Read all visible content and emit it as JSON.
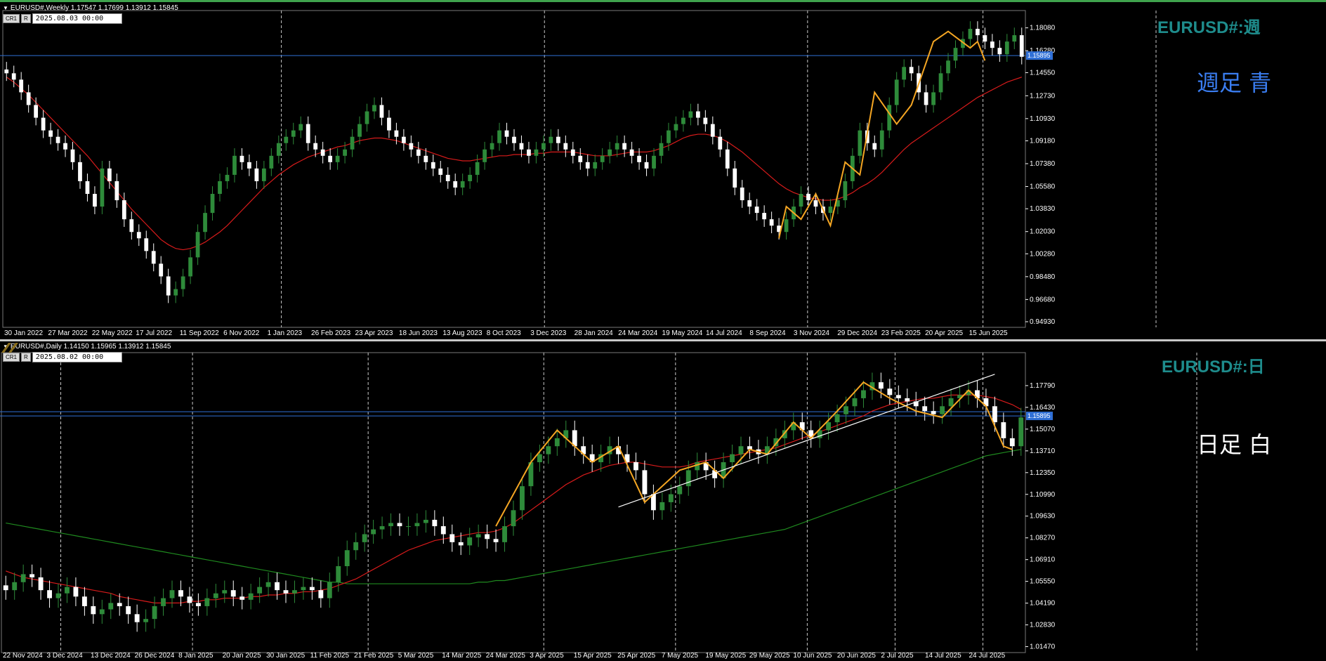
{
  "colors": {
    "background": "#000000",
    "bull": "#2e8b3a",
    "bear": "#ffffff",
    "ma_fast": "#d81b1b",
    "ma_slow": "#1f8a1f",
    "zigzag": "#f5a623",
    "hline": "#2f6fd6",
    "trendline": "#ffffff",
    "weekly_title": "#1e8c8c",
    "weekly_label": "#3a7df0",
    "daily_title": "#1e8c8c",
    "daily_label": "#ffffff",
    "grid": "#c8c8c8"
  },
  "panes": [
    {
      "id": "weekly",
      "header": "EURUSD#,Weekly  1.17547 1.17699 1.13912 1.15845",
      "buttons": [
        "CR1",
        "R"
      ],
      "date_field": "2025.08.03 00:00",
      "title": "EURUSD#:週",
      "label": "週足  青",
      "current_price": "1.15895"
    },
    {
      "id": "daily",
      "header": "EURUSD#,Daily  1.14150 1.15965 1.13912 1.15845",
      "buttons": [
        "CR1",
        "R"
      ],
      "date_field": "2025.08.02 00:00",
      "title": "EURUSD#:日",
      "label": "日足    白",
      "current_price": "1.15895"
    }
  ],
  "chart_data": [
    {
      "type": "candlestick",
      "timeframe": "Weekly",
      "symbol": "EURUSD#",
      "ylim": [
        0.9493,
        1.19
      ],
      "y_ticks": [
        "1.18080",
        "1.16280",
        "1.14550",
        "1.12730",
        "1.10930",
        "1.09180",
        "1.07380",
        "1.05580",
        "1.03830",
        "1.02030",
        "1.00280",
        "0.98480",
        "0.96680",
        "0.94930"
      ],
      "x_labels": [
        "30 Jan 2022",
        "27 Mar 2022",
        "22 May 2022",
        "17 Jul 2022",
        "11 Sep 2022",
        "6 Nov 2022",
        "1 Jan 2023",
        "26 Feb 2023",
        "23 Apr 2023",
        "18 Jun 2023",
        "13 Aug 2023",
        "8 Oct 2023",
        "3 Dec 2023",
        "28 Jan 2024",
        "24 Mar 2024",
        "19 May 2024",
        "14 Jul 2024",
        "8 Sep 2024",
        "3 Nov 2024",
        "29 Dec 2024",
        "23 Feb 2025",
        "20 Apr 2025",
        "15 Jun 2025"
      ],
      "grid_vertical_at": [
        "1 Jan 2023",
        "3 Dec 2023",
        "3 Nov 2024",
        "15 Jun 2025"
      ],
      "horizontal_line": 1.15895,
      "close_trace": [
        1.145,
        1.14,
        1.13,
        1.12,
        1.11,
        1.1,
        1.095,
        1.09,
        1.085,
        1.075,
        1.06,
        1.05,
        1.04,
        1.07,
        1.06,
        1.045,
        1.03,
        1.02,
        1.015,
        1.005,
        0.995,
        0.985,
        0.97,
        0.975,
        0.985,
        1.0,
        1.02,
        1.035,
        1.05,
        1.06,
        1.065,
        1.08,
        1.075,
        1.07,
        1.06,
        1.07,
        1.08,
        1.09,
        1.095,
        1.1,
        1.105,
        1.09,
        1.085,
        1.08,
        1.075,
        1.08,
        1.085,
        1.095,
        1.105,
        1.115,
        1.12,
        1.11,
        1.1,
        1.095,
        1.09,
        1.085,
        1.08,
        1.075,
        1.07,
        1.065,
        1.06,
        1.055,
        1.06,
        1.065,
        1.075,
        1.085,
        1.09,
        1.1,
        1.095,
        1.09,
        1.085,
        1.08,
        1.085,
        1.09,
        1.095,
        1.09,
        1.085,
        1.08,
        1.075,
        1.07,
        1.075,
        1.08,
        1.085,
        1.09,
        1.085,
        1.08,
        1.075,
        1.07,
        1.08,
        1.09,
        1.1,
        1.105,
        1.11,
        1.115,
        1.11,
        1.105,
        1.095,
        1.085,
        1.07,
        1.055,
        1.045,
        1.04,
        1.035,
        1.03,
        1.025,
        1.02,
        1.03,
        1.04,
        1.05,
        1.045,
        1.04,
        1.035,
        1.04,
        1.045,
        1.06,
        1.08,
        1.1,
        1.09,
        1.085,
        1.1,
        1.12,
        1.14,
        1.15,
        1.145,
        1.13,
        1.12,
        1.13,
        1.145,
        1.155,
        1.165,
        1.172,
        1.18,
        1.175,
        1.17,
        1.165,
        1.16,
        1.17,
        1.175,
        1.158
      ],
      "ma_red_trace": [
        1.142,
        1.138,
        1.133,
        1.128,
        1.122,
        1.116,
        1.11,
        1.104,
        1.098,
        1.092,
        1.086,
        1.08,
        1.073,
        1.066,
        1.059,
        1.052,
        1.045,
        1.038,
        1.032,
        1.026,
        1.02,
        1.014,
        1.01,
        1.007,
        1.006,
        1.007,
        1.009,
        1.012,
        1.016,
        1.02,
        1.025,
        1.031,
        1.037,
        1.043,
        1.049,
        1.055,
        1.06,
        1.065,
        1.069,
        1.073,
        1.076,
        1.079,
        1.081,
        1.083,
        1.085,
        1.087,
        1.088,
        1.09,
        1.092,
        1.093,
        1.094,
        1.094,
        1.093,
        1.092,
        1.09,
        1.088,
        1.086,
        1.084,
        1.082,
        1.08,
        1.078,
        1.077,
        1.076,
        1.076,
        1.077,
        1.078,
        1.079,
        1.08,
        1.08,
        1.081,
        1.081,
        1.081,
        1.082,
        1.082,
        1.083,
        1.083,
        1.083,
        1.083,
        1.082,
        1.081,
        1.08,
        1.08,
        1.08,
        1.081,
        1.082,
        1.083,
        1.083,
        1.083,
        1.084,
        1.086,
        1.088,
        1.091,
        1.094,
        1.096,
        1.097,
        1.097,
        1.096,
        1.094,
        1.091,
        1.087,
        1.083,
        1.078,
        1.073,
        1.068,
        1.063,
        1.058,
        1.054,
        1.051,
        1.049,
        1.047,
        1.046,
        1.045,
        1.045,
        1.046,
        1.048,
        1.051,
        1.055,
        1.058,
        1.062,
        1.067,
        1.073,
        1.079,
        1.085,
        1.09,
        1.094,
        1.098,
        1.102,
        1.106,
        1.11,
        1.114,
        1.118,
        1.122,
        1.126,
        1.129,
        1.132,
        1.135,
        1.138,
        1.14,
        1.142
      ],
      "zigzag": [
        [
          105,
          1.015
        ],
        [
          106,
          1.04
        ],
        [
          108,
          1.03
        ],
        [
          110,
          1.05
        ],
        [
          112,
          1.025
        ],
        [
          114,
          1.075
        ],
        [
          116,
          1.065
        ],
        [
          118,
          1.13
        ],
        [
          121,
          1.105
        ],
        [
          123,
          1.12
        ],
        [
          126,
          1.17
        ],
        [
          128,
          1.178
        ],
        [
          131,
          1.165
        ],
        [
          132,
          1.17
        ],
        [
          133,
          1.155
        ]
      ]
    },
    {
      "type": "candlestick",
      "timeframe": "Daily",
      "symbol": "EURUSD#",
      "ylim": [
        1.0145,
        1.195
      ],
      "y_ticks": [
        "1.17790",
        "1.16430",
        "1.15070",
        "1.13710",
        "1.12350",
        "1.10990",
        "1.09630",
        "1.08270",
        "1.06910",
        "1.05550",
        "1.04190",
        "1.02830",
        "1.01470"
      ],
      "x_labels": [
        "22 Nov 2024",
        "3 Dec 2024",
        "13 Dec 2024",
        "26 Dec 2024",
        "8 Jan 2025",
        "20 Jan 2025",
        "30 Jan 2025",
        "11 Feb 2025",
        "21 Feb 2025",
        "5 Mar 2025",
        "14 Mar 2025",
        "24 Mar 2025",
        "3 Apr 2025",
        "15 Apr 2025",
        "25 Apr 2025",
        "7 May 2025",
        "19 May 2025",
        "29 May 2025",
        "10 Jun 2025",
        "20 Jun 2025",
        "2 Jul 2025",
        "14 Jul 2025",
        "24 Jul 2025"
      ],
      "grid_vertical_at": [
        "3 Dec 2024",
        "8 Jan 2025",
        "21 Feb 2025",
        "3 Apr 2025",
        "7 May 2025",
        "10 Jun 2025",
        "2 Jul 2025",
        "24 Jul 2025"
      ],
      "horizontal_line": 1.15895,
      "close_trace": [
        1.05,
        1.055,
        1.06,
        1.058,
        1.05,
        1.045,
        1.048,
        1.052,
        1.046,
        1.04,
        1.035,
        1.038,
        1.042,
        1.04,
        1.035,
        1.03,
        1.032,
        1.04,
        1.045,
        1.05,
        1.046,
        1.042,
        1.04,
        1.045,
        1.048,
        1.05,
        1.046,
        1.044,
        1.048,
        1.052,
        1.055,
        1.05,
        1.048,
        1.05,
        1.052,
        1.05,
        1.045,
        1.055,
        1.065,
        1.075,
        1.08,
        1.085,
        1.088,
        1.09,
        1.092,
        1.09,
        1.09,
        1.092,
        1.094,
        1.09,
        1.085,
        1.08,
        1.078,
        1.083,
        1.085,
        1.082,
        1.08,
        1.09,
        1.1,
        1.115,
        1.13,
        1.135,
        1.14,
        1.145,
        1.15,
        1.14,
        1.135,
        1.13,
        1.135,
        1.14,
        1.135,
        1.13,
        1.125,
        1.11,
        1.1,
        1.105,
        1.11,
        1.115,
        1.125,
        1.13,
        1.125,
        1.12,
        1.13,
        1.135,
        1.14,
        1.138,
        1.135,
        1.14,
        1.145,
        1.15,
        1.155,
        1.15,
        1.145,
        1.15,
        1.155,
        1.16,
        1.165,
        1.17,
        1.175,
        1.18,
        1.176,
        1.172,
        1.17,
        1.168,
        1.165,
        1.162,
        1.16,
        1.165,
        1.17,
        1.172,
        1.175,
        1.17,
        1.165,
        1.155,
        1.145,
        1.14,
        1.158
      ],
      "ma_red_trace": [
        1.062,
        1.06,
        1.058,
        1.057,
        1.056,
        1.055,
        1.054,
        1.053,
        1.052,
        1.051,
        1.05,
        1.049,
        1.048,
        1.046,
        1.045,
        1.044,
        1.043,
        1.042,
        1.042,
        1.042,
        1.042,
        1.043,
        1.043,
        1.044,
        1.044,
        1.045,
        1.045,
        1.045,
        1.046,
        1.046,
        1.047,
        1.047,
        1.048,
        1.048,
        1.049,
        1.049,
        1.05,
        1.051,
        1.053,
        1.055,
        1.057,
        1.06,
        1.063,
        1.066,
        1.069,
        1.072,
        1.075,
        1.077,
        1.079,
        1.081,
        1.082,
        1.083,
        1.084,
        1.085,
        1.086,
        1.086,
        1.087,
        1.089,
        1.092,
        1.096,
        1.1,
        1.104,
        1.108,
        1.112,
        1.116,
        1.119,
        1.122,
        1.124,
        1.126,
        1.128,
        1.129,
        1.13,
        1.13,
        1.129,
        1.128,
        1.127,
        1.127,
        1.127,
        1.128,
        1.13,
        1.131,
        1.132,
        1.133,
        1.134,
        1.135,
        1.136,
        1.137,
        1.138,
        1.139,
        1.141,
        1.143,
        1.145,
        1.147,
        1.149,
        1.151,
        1.153,
        1.155,
        1.157,
        1.159,
        1.162,
        1.164,
        1.166,
        1.167,
        1.168,
        1.169,
        1.17,
        1.17,
        1.171,
        1.172,
        1.172,
        1.172,
        1.172,
        1.171,
        1.17,
        1.168,
        1.166,
        1.163
      ],
      "ma_green_trace": [
        1.092,
        1.091,
        1.09,
        1.089,
        1.088,
        1.087,
        1.086,
        1.085,
        1.084,
        1.083,
        1.082,
        1.081,
        1.08,
        1.079,
        1.078,
        1.077,
        1.076,
        1.075,
        1.074,
        1.073,
        1.072,
        1.071,
        1.07,
        1.069,
        1.068,
        1.067,
        1.066,
        1.065,
        1.064,
        1.063,
        1.062,
        1.061,
        1.06,
        1.059,
        1.058,
        1.057,
        1.056,
        1.055,
        1.055,
        1.054,
        1.054,
        1.054,
        1.054,
        1.054,
        1.054,
        1.054,
        1.054,
        1.054,
        1.054,
        1.054,
        1.054,
        1.054,
        1.054,
        1.054,
        1.055,
        1.055,
        1.056,
        1.056,
        1.057,
        1.058,
        1.059,
        1.06,
        1.061,
        1.062,
        1.063,
        1.064,
        1.065,
        1.066,
        1.067,
        1.068,
        1.069,
        1.07,
        1.071,
        1.072,
        1.073,
        1.074,
        1.075,
        1.076,
        1.077,
        1.078,
        1.079,
        1.08,
        1.081,
        1.082,
        1.083,
        1.084,
        1.085,
        1.086,
        1.087,
        1.088,
        1.09,
        1.092,
        1.094,
        1.096,
        1.098,
        1.1,
        1.102,
        1.104,
        1.106,
        1.108,
        1.11,
        1.112,
        1.114,
        1.116,
        1.118,
        1.12,
        1.122,
        1.124,
        1.126,
        1.128,
        1.13,
        1.132,
        1.134,
        1.135,
        1.136,
        1.137,
        1.138
      ],
      "zigzag": [
        [
          56,
          1.09
        ],
        [
          60,
          1.13
        ],
        [
          63,
          1.15
        ],
        [
          67,
          1.13
        ],
        [
          70,
          1.14
        ],
        [
          73,
          1.105
        ],
        [
          77,
          1.125
        ],
        [
          80,
          1.13
        ],
        [
          82,
          1.12
        ],
        [
          85,
          1.138
        ],
        [
          87,
          1.135
        ],
        [
          90,
          1.155
        ],
        [
          92,
          1.145
        ],
        [
          95,
          1.162
        ],
        [
          98,
          1.18
        ],
        [
          101,
          1.17
        ],
        [
          104,
          1.162
        ],
        [
          107,
          1.158
        ],
        [
          110,
          1.175
        ],
        [
          112,
          1.165
        ],
        [
          114,
          1.14
        ],
        [
          115,
          1.138
        ]
      ],
      "trendline": [
        [
          70,
          1.102
        ],
        [
          113,
          1.185
        ]
      ]
    }
  ]
}
